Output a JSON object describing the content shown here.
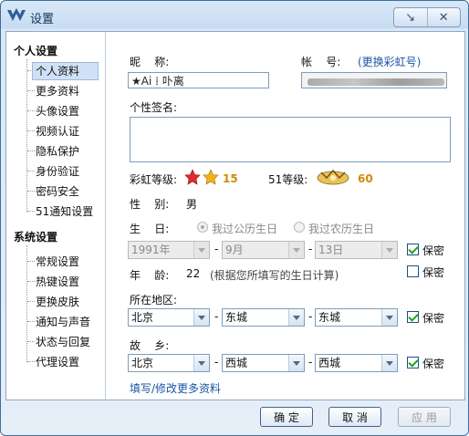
{
  "window": {
    "title": "设置",
    "controls": [
      "↘",
      "✕"
    ]
  },
  "sidebar": {
    "groups": [
      {
        "label": "个人设置",
        "items": [
          "个人资料",
          "更多资料",
          "头像设置",
          "视频认证",
          "隐私保护",
          "身份验证",
          "密码安全",
          "51通知设置"
        ]
      },
      {
        "label": "系统设置",
        "items": [
          "常规设置",
          "热键设置",
          "更换皮肤",
          "通知与声音",
          "状态与回复",
          "代理设置"
        ]
      }
    ],
    "selected": "个人资料"
  },
  "form": {
    "nickname_label": "昵    称:",
    "nickname_value": "★Ai ⁞ 卟离",
    "account_label": "帐    号:",
    "change_rainbow_link": "(更换彩虹号)",
    "signature_label": "个性签名:",
    "rainbow_level_label": "彩虹等级:",
    "rainbow_level_value": "15",
    "level51_label": "51等级:",
    "level51_value": "60",
    "gender_label": "性    别:",
    "gender_value": "男",
    "birthday_label": "生    日:",
    "solar_option": "我过公历生日",
    "lunar_option": "我过农历生日",
    "year": "1991年",
    "month": "9月",
    "day": "13日",
    "privacy": "保密",
    "age_label": "年    龄:",
    "age_value": "22",
    "age_note": "(根据您所填写的生日计算)",
    "region_label": "所在地区:",
    "region": [
      "北京",
      "东城",
      "东城"
    ],
    "hometown_label": "故    乡:",
    "hometown": [
      "北京",
      "西城",
      "西城"
    ],
    "more_link": "填写/修改更多资料"
  },
  "buttons": {
    "ok": "确 定",
    "cancel": "取 消",
    "apply": "应 用"
  },
  "colors": {
    "accent": "#1a55a6",
    "border": "#3f6f9f",
    "check": "#21a121"
  }
}
